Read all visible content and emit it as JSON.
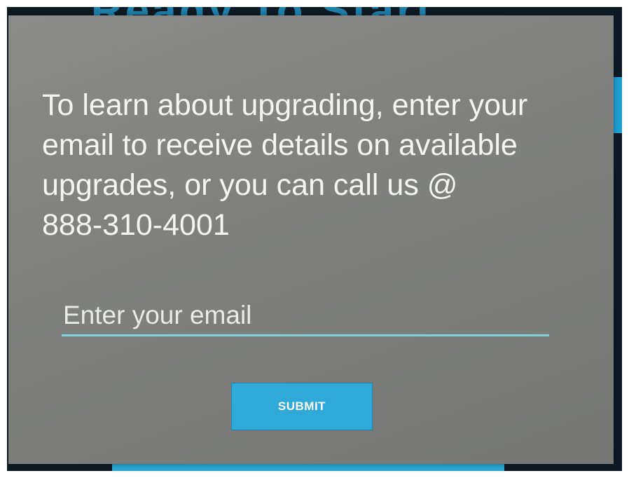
{
  "dialog": {
    "message": "To learn about upgrading, enter your\nemail to receive details on available\nupgrades, or you can call us @\n888-310-4001",
    "email_input": {
      "value": "",
      "placeholder": "Enter your email"
    },
    "submit_label": "SUBMIT"
  },
  "colors": {
    "dialog_background": "#808180",
    "text": "#f4f4f2",
    "input_underline": "#7fd3d8",
    "button_background": "#2fa9da",
    "button_text": "#ffffff"
  }
}
